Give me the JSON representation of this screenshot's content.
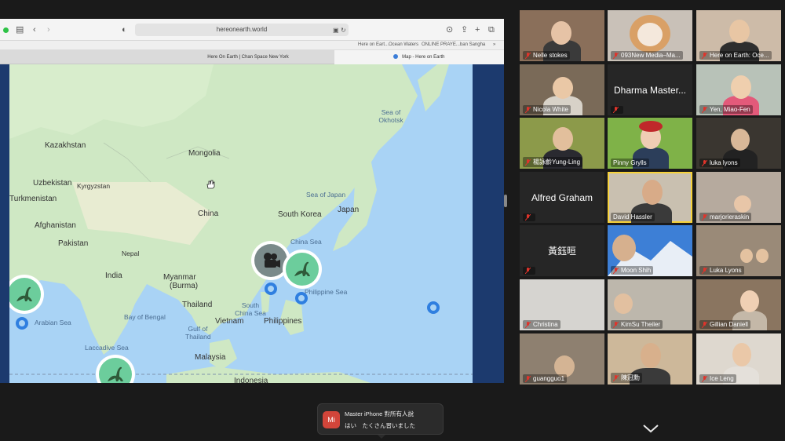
{
  "browser": {
    "url": "hereonearth.world",
    "bookmarks": [
      "Here on Eart...Ocean Waters",
      "ONLINE PRAYE...ban Sangha"
    ],
    "tabs": [
      "Here On Earth | Chan Space New York",
      "Map - Here on Earth"
    ]
  },
  "map": {
    "labels": {
      "kazakhstan": "Kazakhstan",
      "mongolia": "Mongolia",
      "uzbekistan": "Uzbekistan",
      "kyrgyzstan": "Kyrgyzstan",
      "turkmenistan": "Turkmenistan",
      "china": "China",
      "afghanistan": "Afghanistan",
      "pakistan": "Pakistan",
      "nepal": "Nepal",
      "india": "India",
      "myanmar": "Myanmar",
      "burma": "(Burma)",
      "thailand": "Thailand",
      "vietnam": "Vietnam",
      "philippines": "Philippines",
      "malaysia": "Malaysia",
      "indonesia": "Indonesia",
      "south_korea": "South Korea",
      "japan": "Japan",
      "sea_okhotsk": "Sea of Okhotsk",
      "sea_japan": "Sea of Japan",
      "east_china_sea": "China Sea",
      "south_china_sea": "South China Sea",
      "philippine_sea": "Philippine Sea",
      "bay_bengal": "Bay of Bengal",
      "gulf_thailand": "Gulf of Thailand",
      "arabian_sea": "Arabian Sea",
      "laccadive_sea": "Laccadive Sea"
    },
    "pin_icons": [
      "camera-icon",
      "dinosaur-icon"
    ]
  },
  "participants": [
    {
      "name": "Nelle stokes"
    },
    {
      "name": "093New Media–Ma..."
    },
    {
      "name": "Here on Earth: Oce..."
    },
    {
      "name": "Nicola White"
    },
    {
      "name": "Dharma Master..."
    },
    {
      "name": "Yen, Miao-Fen"
    },
    {
      "name": "楊詠齡Yung-Ling"
    },
    {
      "name": "Pinny Grylls"
    },
    {
      "name": "luka lyons"
    },
    {
      "name": "Alfred Graham"
    },
    {
      "name": "David Hassler"
    },
    {
      "name": "marjorieraskin"
    },
    {
      "name": "黃鈺晅"
    },
    {
      "name": "Moon Shih"
    },
    {
      "name": "Luka Lyons"
    },
    {
      "name": "Christina"
    },
    {
      "name": "KimSu Theiler"
    },
    {
      "name": "Gillian Daniell"
    },
    {
      "name": "guangguo1"
    },
    {
      "name": "陳冠勳"
    },
    {
      "name": "Ice Leng"
    }
  ],
  "chat_toast": {
    "avatar": "Mi",
    "title": "Master iPhone 對所有人說",
    "message": "はい　たくさん習いました"
  },
  "colors": {
    "ocean": "#a9d3f5",
    "land": "#cfe8c4",
    "pin": "#6ccd9c",
    "ring": "#2f7fe0",
    "speaker": "#f7d23a",
    "mute": "#e0342b"
  }
}
